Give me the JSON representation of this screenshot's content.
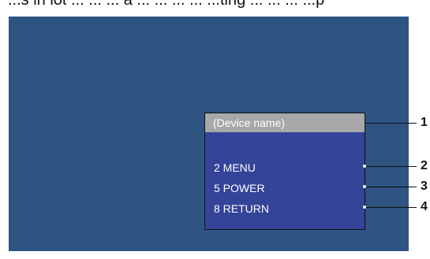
{
  "top_text": "...s in lot ... ... ... a ... ... ... ... ...ting ... ... ... ...p",
  "osd": {
    "header": "(Device name)",
    "items": [
      {
        "label": "2 MENU"
      },
      {
        "label": "5 POWER"
      },
      {
        "label": "8 RETURN"
      }
    ]
  },
  "callouts": [
    "1",
    "2",
    "3",
    "4"
  ],
  "colors": {
    "screen_bg": "#2e5482",
    "osd_bg": "#354399",
    "header_bg": "#a8a8a8",
    "text": "#ffffff"
  }
}
